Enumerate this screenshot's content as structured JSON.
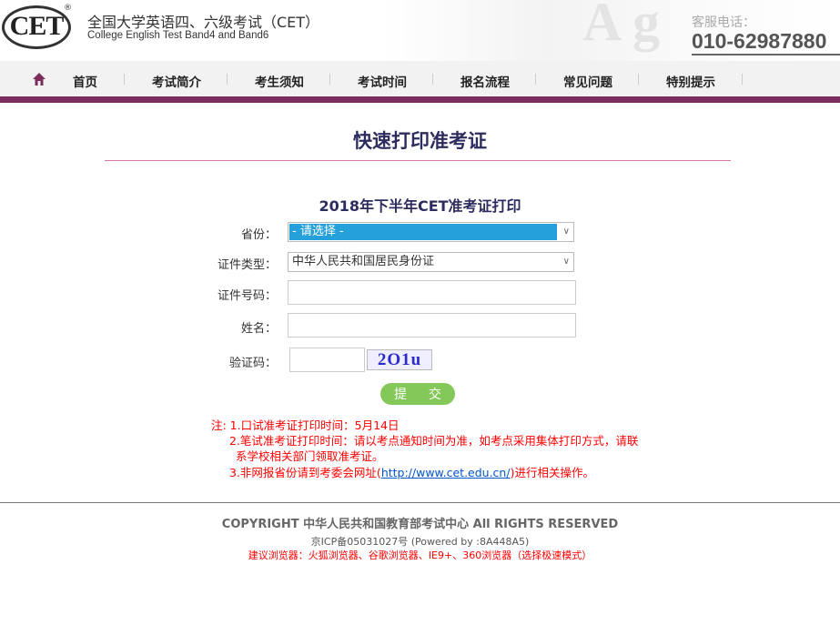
{
  "header": {
    "logo_text": "CET",
    "logo_reg": "®",
    "title_cn": "全国大学英语四、六级考试（CET）",
    "title_en": "College English Test Band4 and Band6",
    "watermark": "A g",
    "hotline_label": "客服电话：",
    "hotline_number": "010-62987880"
  },
  "nav": {
    "home_icon": "home-icon",
    "items": [
      "首页",
      "考试简介",
      "考生须知",
      "考试时间",
      "报名流程",
      "常见问题",
      "特别提示"
    ]
  },
  "page_title": "快速打印准考证",
  "form": {
    "title": "2018年下半年CET准考证打印",
    "province_label": "省份：",
    "province_value": "- 请选择 -",
    "idtype_label": "证件类型：",
    "idtype_value": "中华人民共和国居民身份证",
    "idnum_label": "证件号码：",
    "idnum_value": "",
    "name_label": "姓名：",
    "name_value": "",
    "captcha_label": "验证码：",
    "captcha_value": "",
    "captcha_image_text": "2O1u",
    "submit_label": "提 交"
  },
  "notes": {
    "n1": "注: 1.口试准考证打印时间：5月14日",
    "n2a": "2.笔试准考证打印时间：请以考点通知时间为准，如考点采用集体打印方式，请联",
    "n2b": "系学校相关部门领取准考证。",
    "n3_pre": "3.非网报省份请到考委会网址(",
    "n3_link": "http://www.cet.edu.cn/",
    "n3_post": ")进行相关操作。"
  },
  "footer": {
    "copyright": "COPYRIGHT 中华人民共和国教育部考试中心 All RIGHTS RESERVED",
    "icp": "京ICP备05031027号 (Powered by :8A448A5)",
    "browser": "建议浏览器：火狐浏览器、谷歌浏览器、IE9+、360浏览器（选择极速模式）"
  },
  "colors": {
    "nav_bar": "#7b2d5e",
    "title": "#2c2c5e",
    "submit": "#85c85a",
    "note": "#ff0000",
    "select_highlight": "#26a0da"
  }
}
